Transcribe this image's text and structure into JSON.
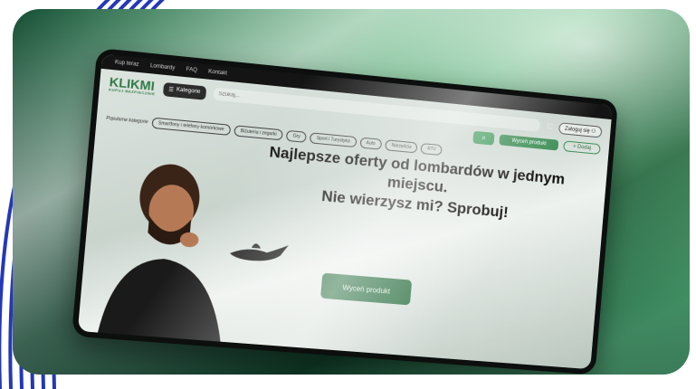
{
  "topnav": {
    "items": [
      "Kup teraz",
      "Lombardy",
      "FAQ",
      "Kontakt"
    ]
  },
  "header": {
    "logo_text": "KLIKMI",
    "logo_tagline": "KUPUJ BEZPIECZNIE",
    "category_button": "Kategorie",
    "search_placeholder": "Szukaj...",
    "login_label": "Zaloguj się",
    "search_icon": "search-icon",
    "heart_icon": "heart-icon",
    "user_icon": "user-icon"
  },
  "actions": {
    "valuate_label": "Wyceń produkt",
    "add_label": "+ Dodaj"
  },
  "categories": {
    "label": "Popularne kategorie",
    "items": [
      "Smartfony i telefony komórkowe",
      "Biżuteria i zegarki",
      "Gry",
      "Sport i Turystyka",
      "Auto",
      "Narzędzia",
      "RTV"
    ]
  },
  "hero": {
    "line1": "Najlepsze oferty od lombardów w jednym",
    "line2": "miejscu.",
    "line3": "Nie wierzysz mi? Sprobuj!",
    "button_label": "Wyceń produkt"
  },
  "colors": {
    "brand": "#2f7a47",
    "accent": "#3a8d54",
    "dark": "#141414"
  }
}
